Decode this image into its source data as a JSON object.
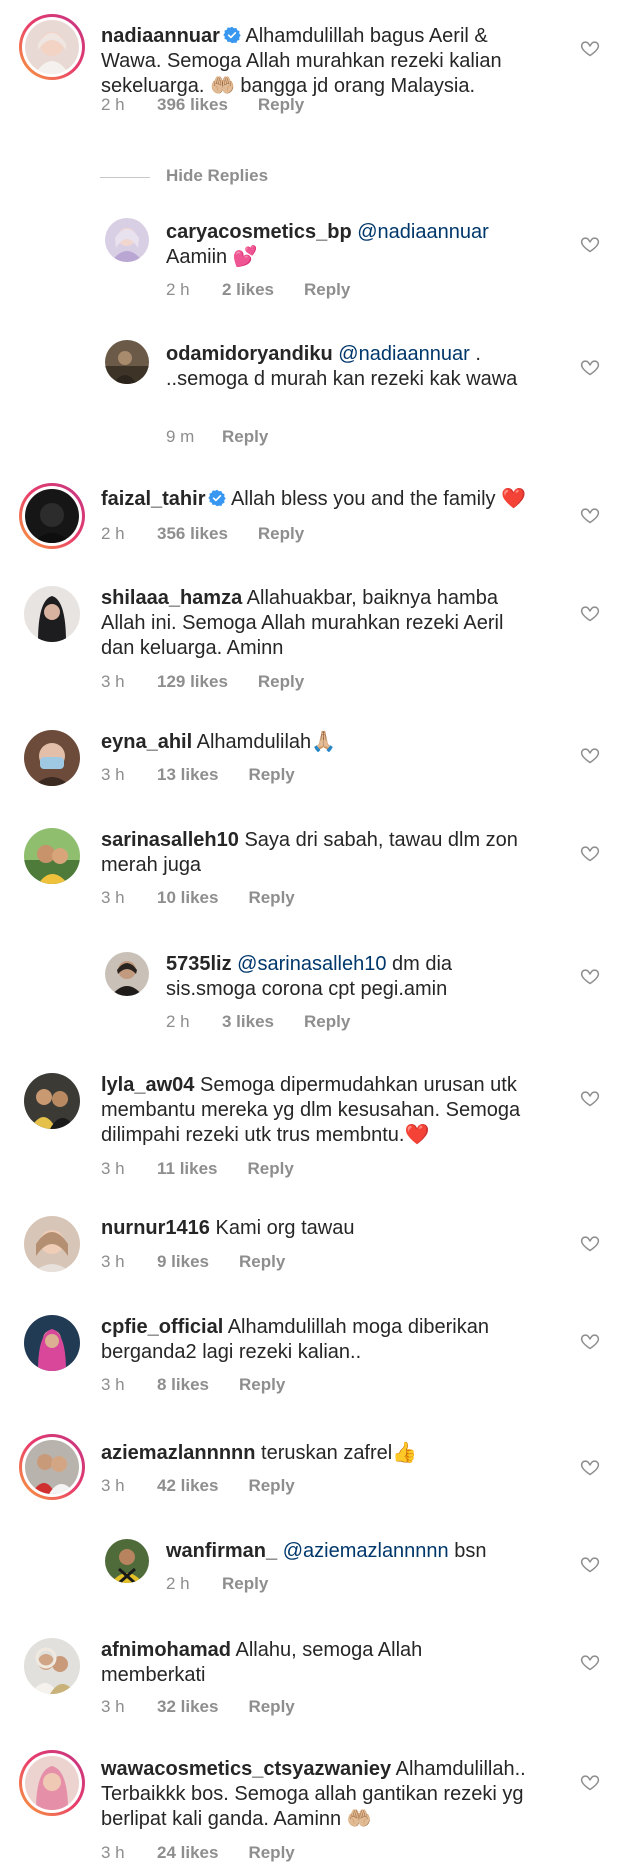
{
  "hide_replies_label": "Hide Replies",
  "comments": [
    {
      "username": "nadiaannuar",
      "verified": true,
      "text": "Alhamdulillah bagus Aeril & Wawa. Semoga Allah murahkan rezeki kalian sekeluarga. 🤲🏼 bangga jd orang Malaysia.",
      "time": "2 h",
      "likes": "396 likes",
      "reply": "Reply"
    },
    {
      "username": "caryacosmetics_bp",
      "mention": "@nadiaannuar",
      "text": "Aamiin 💕",
      "time": "2 h",
      "likes": "2 likes",
      "reply": "Reply"
    },
    {
      "username": "odamidoryandiku",
      "mention": "@nadiaannuar",
      "text": ". ..semoga d murah kan rezeki kak wawa",
      "time": "9 m",
      "likes": "",
      "reply": "Reply"
    },
    {
      "username": "faizal_tahir",
      "verified": true,
      "text": "Allah bless you and the family ❤️",
      "time": "2 h",
      "likes": "356 likes",
      "reply": "Reply"
    },
    {
      "username": "shilaaa_hamza",
      "text": "Allahuakbar, baiknya hamba Allah ini. Semoga Allah murahkan rezeki Aeril dan keluarga. Aminn",
      "time": "3 h",
      "likes": "129 likes",
      "reply": "Reply"
    },
    {
      "username": "eyna_ahil",
      "text": "Alhamdulilah🙏🏼",
      "time": "3 h",
      "likes": "13 likes",
      "reply": "Reply"
    },
    {
      "username": "sarinasalleh10",
      "text": "Saya dri sabah, tawau dlm zon merah juga",
      "time": "3 h",
      "likes": "10 likes",
      "reply": "Reply"
    },
    {
      "username": "5735liz",
      "mention": "@sarinasalleh10",
      "text": "dm dia sis.smoga corona cpt pegi.amin",
      "time": "2 h",
      "likes": "3 likes",
      "reply": "Reply"
    },
    {
      "username": "lyla_aw04",
      "text": "Semoga dipermudahkan urusan utk membantu mereka yg dlm kesusahan. Semoga dilimpahi rezeki utk trus membntu.❤️",
      "time": "3 h",
      "likes": "11 likes",
      "reply": "Reply"
    },
    {
      "username": "nurnur1416",
      "text": "Kami org tawau",
      "time": "3 h",
      "likes": "9 likes",
      "reply": "Reply"
    },
    {
      "username": "cpfie_official",
      "text": "Alhamdulillah moga diberikan berganda2 lagi rezeki kalian..",
      "time": "3 h",
      "likes": "8 likes",
      "reply": "Reply"
    },
    {
      "username": "aziemazlannnnn",
      "text": "teruskan zafrel👍",
      "time": "3 h",
      "likes": "42 likes",
      "reply": "Reply"
    },
    {
      "username": "wanfirman_",
      "mention": "@aziemazlannnnn",
      "text": "bsn",
      "time": "2 h",
      "likes": "",
      "reply": "Reply"
    },
    {
      "username": "afnimohamad",
      "text": "Allahu, semoga Allah memberkati",
      "time": "3 h",
      "likes": "32 likes",
      "reply": "Reply"
    },
    {
      "username": "wawacosmetics_ctsyazwaniey",
      "text": "Alhamdulillah.. Terbaikkk bos. Semoga allah gantikan rezeki yg berlipat kali ganda. Aaminn 🤲🏼",
      "time": "3 h",
      "likes": "24 likes",
      "reply": "Reply"
    }
  ]
}
